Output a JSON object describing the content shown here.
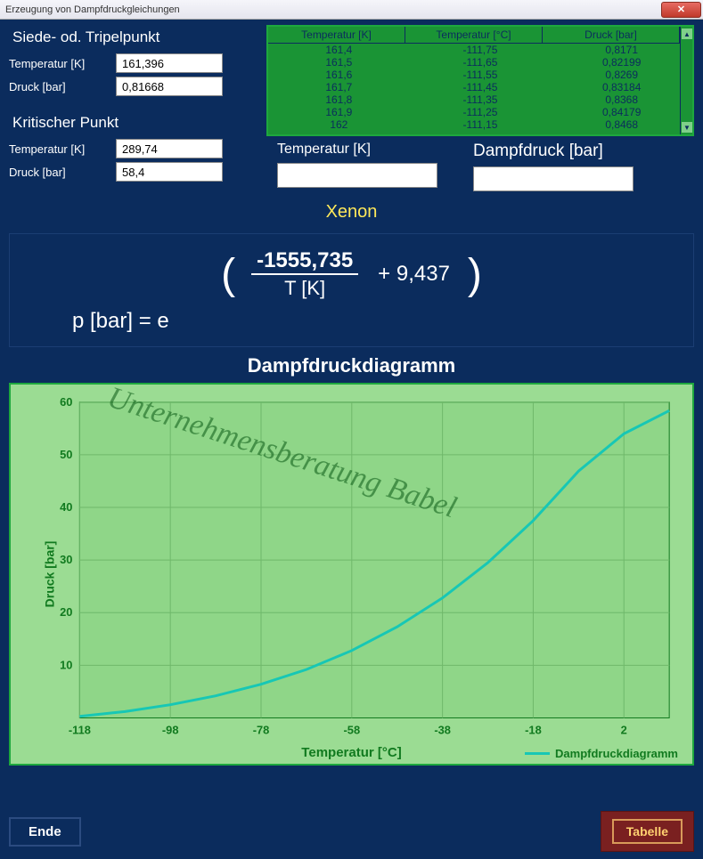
{
  "window": {
    "title": "Erzeugung von Dampfdruckgleichungen",
    "close_glyph": "✕"
  },
  "boiling": {
    "heading": "Siede- od. Tripelpunkt",
    "temp_label": "Temperatur [K]",
    "temp_value": "161,396",
    "press_label": "Druck  [bar]",
    "press_value": "0,81668"
  },
  "critical": {
    "heading": "Kritischer Punkt",
    "temp_label": "Temperatur [K]",
    "temp_value": "289,74",
    "press_label": "Druck  [bar]",
    "press_value": "58,4"
  },
  "table": {
    "headers": [
      "Temperatur [K]",
      "Temperatur [°C]",
      "Druck [bar]"
    ],
    "rows": [
      [
        "161,4",
        "-111,75",
        "0,8171"
      ],
      [
        "161,5",
        "-111,65",
        "0,82199"
      ],
      [
        "161,6",
        "-111,55",
        "0,8269"
      ],
      [
        "161,7",
        "-111,45",
        "0,83184"
      ],
      [
        "161,8",
        "-111,35",
        "0,8368"
      ],
      [
        "161,9",
        "-111,25",
        "0,84179"
      ],
      [
        "162",
        "-111,15",
        "0,8468"
      ]
    ]
  },
  "calc": {
    "temp_label": "Temperatur [K]",
    "press_label": "Dampfdruck [bar]",
    "temp_value": "",
    "press_value": ""
  },
  "substance": "Xenon",
  "formula": {
    "lhs": "p [bar] = e",
    "numerator": "-1555,735",
    "denominator": "T [K]",
    "plus": "+ 9,437"
  },
  "chart": {
    "title": "Dampfdruckdiagramm",
    "ylabel": "Druck  [bar]",
    "xlabel": "Temperatur [°C]",
    "legend": "Dampfdruckdiagramm",
    "watermark": "Unternehmensberatung Babel"
  },
  "buttons": {
    "end": "Ende",
    "table": "Tabelle"
  },
  "chart_data": {
    "type": "line",
    "title": "Dampfdruckdiagramm",
    "xlabel": "Temperatur [°C]",
    "ylabel": "Druck [bar]",
    "xlim": [
      -118,
      12
    ],
    "ylim": [
      0,
      60
    ],
    "xticks": [
      -118,
      -98,
      -78,
      -58,
      -38,
      -18,
      2
    ],
    "yticks": [
      10,
      20,
      30,
      40,
      50,
      60
    ],
    "series": [
      {
        "name": "Dampfdruckdiagramm",
        "x": [
          -118,
          -108,
          -98,
          -88,
          -78,
          -68,
          -58,
          -48,
          -38,
          -28,
          -18,
          -8,
          2,
          12
        ],
        "values": [
          0.3,
          1.2,
          2.5,
          4.2,
          6.4,
          9.2,
          12.8,
          17.3,
          22.8,
          29.5,
          37.5,
          46.9,
          54.0,
          58.4
        ]
      }
    ]
  }
}
